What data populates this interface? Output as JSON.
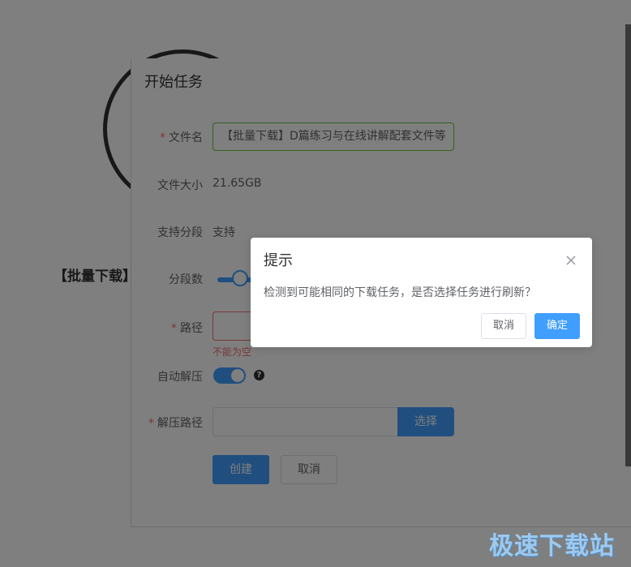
{
  "background": {
    "title": "【批量下载】"
  },
  "task_dialog": {
    "title": "开始任务",
    "filename": {
      "label": "文件名",
      "value": "【批量下载】D篇练习与在线讲解配套文件等"
    },
    "file_size": {
      "label": "文件大小",
      "value": "21.65GB"
    },
    "segment_support": {
      "label": "支持分段",
      "value": "支持"
    },
    "segments": {
      "label": "分段数"
    },
    "path": {
      "label": "路径",
      "value": "",
      "error": "不能为空"
    },
    "auto_unzip": {
      "label": "自动解压",
      "enabled": true,
      "help_icon": "question-circle-icon"
    },
    "unzip_path": {
      "label": "解压路径",
      "value": "",
      "select_label": "选择"
    },
    "create_label": "创建",
    "cancel_label": "取消"
  },
  "message_box": {
    "title": "提示",
    "close_icon": "close-icon",
    "content": "检测到可能相同的下载任务，是否选择任务进行刷新？",
    "cancel_label": "取消",
    "confirm_label": "确定"
  },
  "watermark": "极速下载站",
  "colors": {
    "primary": "#409eff",
    "danger": "#f56c6c",
    "success": "#67c23a",
    "overlay": "rgba(0,0,0,0.5)"
  }
}
